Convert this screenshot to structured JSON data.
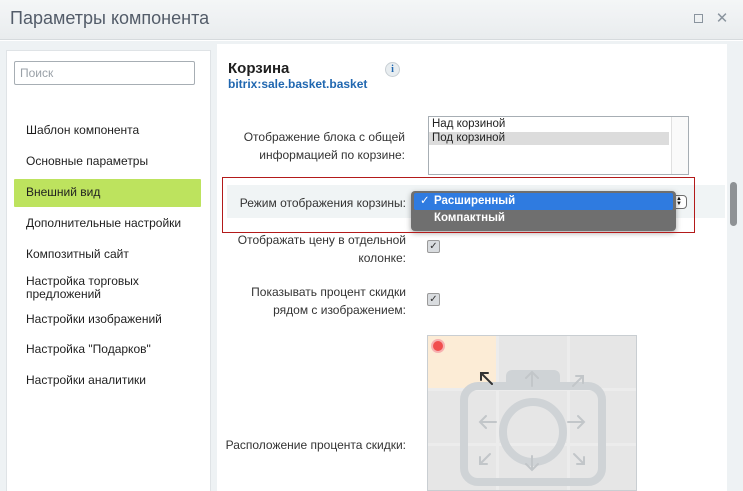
{
  "window": {
    "title": "Параметры компонента",
    "maximize_icon": "maximize-icon",
    "close_icon": "close-icon",
    "close_glyph": "✕"
  },
  "sidebar": {
    "search_placeholder": "Поиск",
    "items": [
      {
        "label": "Шаблон компонента",
        "active": false
      },
      {
        "label": "Основные параметры",
        "active": false
      },
      {
        "label": "Внешний вид",
        "active": true
      },
      {
        "label": "Дополнительные настройки",
        "active": false
      },
      {
        "label": "Композитный сайт",
        "active": false
      },
      {
        "label": "Настройка торговых предложений",
        "active": false
      },
      {
        "label": "Настройки изображений",
        "active": false
      },
      {
        "label": "Настройка \"Подарков\"",
        "active": false
      },
      {
        "label": "Настройки аналитики",
        "active": false
      }
    ],
    "active_color": "#bde35e"
  },
  "component": {
    "title": "Корзина",
    "id": "bitrix:sale.basket.basket",
    "info_icon": "i"
  },
  "params": {
    "summary_block": {
      "label": "Отображение блока с общей информацией по корзине:",
      "options": [
        "Над корзиной",
        "Под корзиной"
      ],
      "selected": "Под корзиной"
    },
    "view_mode": {
      "label": "Режим отображения корзины:",
      "options": [
        "Расширенный",
        "Компактный"
      ],
      "selected": "Расширенный",
      "check_glyph": "✓"
    },
    "price_column": {
      "label": "Отображать цену в отдельной колонке:",
      "checked": true
    },
    "discount_near_image": {
      "label": "Показывать процент скидки рядом с изображением:",
      "checked": true
    },
    "discount_position": {
      "label": "Расположение процента скидки:",
      "selected_cell": "top-left"
    }
  },
  "colors": {
    "highlight_border": "#b31a1a",
    "dropdown_selected": "#2f7be0",
    "link_blue": "#2067b0"
  }
}
